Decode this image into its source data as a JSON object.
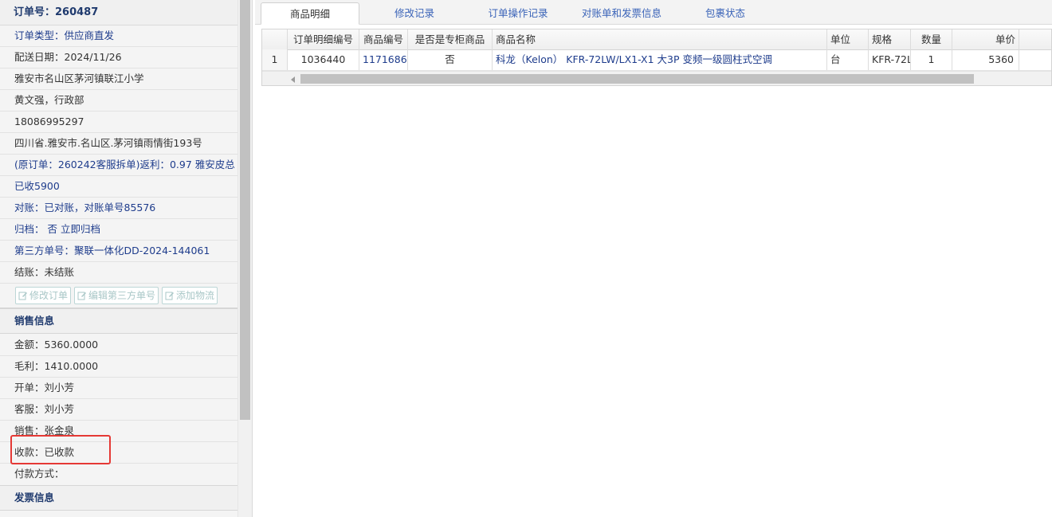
{
  "order": {
    "header": "订单号：260487",
    "rows": [
      {
        "text": "订单类型：供应商直发",
        "style": "blue"
      },
      {
        "text": "配送日期：2024/11/26",
        "style": "dark"
      },
      {
        "text": "雅安市名山区茅河镇联江小学",
        "style": "dark"
      },
      {
        "text": "黄文强，行政部",
        "style": "dark"
      },
      {
        "text": "18086995297",
        "style": "dark"
      },
      {
        "text": "四川省.雅安市.名山区.茅河镇雨情街193号",
        "style": "dark"
      },
      {
        "text": "(原订单：260242客服拆单)返利：0.97 雅安皮总",
        "style": "blue"
      },
      {
        "text": "已收5900",
        "style": "blue"
      },
      {
        "text": "对账：已对账，对账单号85576",
        "style": "blue"
      },
      {
        "text": "归档： 否 立即归档",
        "style": "blue"
      },
      {
        "text": "第三方单号：聚联一体化DD-2024-144061",
        "style": "blue"
      },
      {
        "text": "结账：未结账",
        "style": "dark"
      }
    ],
    "actions": [
      "修改订单",
      "编辑第三方单号",
      "添加物流"
    ]
  },
  "sales": {
    "title": "销售信息",
    "amount": "金额：5360.0000",
    "profit": "毛利：1410.0000",
    "issuer": "开单：刘小芳",
    "service": "客服：刘小芳",
    "seller": "销售：张金泉",
    "payment_status": "收款：已收款",
    "payment_method": "付款方式："
  },
  "invoice": {
    "title": "发票信息"
  },
  "tabs": [
    "商品明细",
    "修改记录",
    "订单操作记录",
    "对账单和发票信息",
    "包裹状态"
  ],
  "grid": {
    "headers": [
      "",
      "订单明细编号",
      "商品编号",
      "是否是专柜商品",
      "商品名称",
      "单位",
      "规格",
      "数量",
      "单价"
    ],
    "row": {
      "index": "1",
      "detail_id": "1036440",
      "product_id": "1171686",
      "is_counter": "否",
      "name": "科龙（Kelon） KFR-72LW/LX1-X1 大3P 变频一级圆柱式空调",
      "unit": "台",
      "spec": "KFR-72L",
      "qty": "1",
      "price": "5360"
    }
  },
  "colors": {
    "link": "#1e3c8c",
    "highlight": "#e53935"
  }
}
